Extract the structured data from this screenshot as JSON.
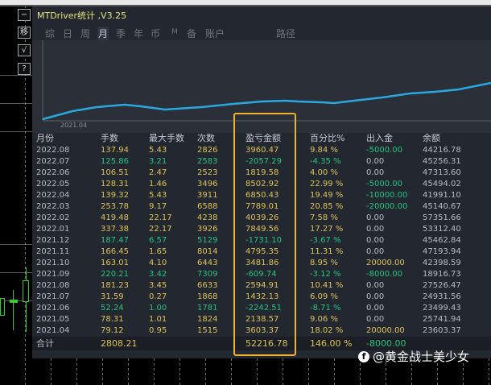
{
  "window": {
    "title": "MTDriver统计 ,V3.25"
  },
  "side_buttons": [
    "−",
    "移",
    "√",
    "?"
  ],
  "tabs": [
    {
      "label": "综",
      "active": false
    },
    {
      "label": "日",
      "active": false
    },
    {
      "label": "周",
      "active": false
    },
    {
      "label": "月",
      "active": true
    },
    {
      "label": "季",
      "active": false
    },
    {
      "label": "年",
      "active": false
    },
    {
      "label": "币",
      "active": false
    },
    {
      "label": "M",
      "active": false
    },
    {
      "label": "备",
      "active": false
    },
    {
      "label": "账户",
      "active": false
    },
    {
      "label": "路径",
      "active": false
    }
  ],
  "chart": {
    "start_label": "2021.04"
  },
  "table": {
    "headers": [
      "月份",
      "手数",
      "最大手数",
      "次数",
      "盈亏金额",
      "百分比%",
      "出入金",
      "余额"
    ],
    "rows": [
      [
        "2022.08",
        "137.94",
        "5.43",
        "2826",
        "3960.47",
        "9.84 %",
        "-5000.00",
        "44216.78"
      ],
      [
        "2022.07",
        "125.86",
        "3.21",
        "2583",
        "-2057.29",
        "-4.35 %",
        "0.00",
        "45256.31"
      ],
      [
        "2022.06",
        "106.51",
        "2.47",
        "2523",
        "1819.58",
        "4.00 %",
        "0.00",
        "47313.60"
      ],
      [
        "2022.05",
        "128.31",
        "1.46",
        "3496",
        "8502.92",
        "22.99 %",
        "-5000.00",
        "45494.02"
      ],
      [
        "2022.04",
        "139.32",
        "5.43",
        "3911",
        "6850.43",
        "19.49 %",
        "-10000.00",
        "41991.10"
      ],
      [
        "2022.03",
        "253.78",
        "9.17",
        "6588",
        "7789.01",
        "20.85 %",
        "-20000.00",
        "45140.67"
      ],
      [
        "2022.02",
        "419.48",
        "22.17",
        "4238",
        "4039.26",
        "7.58 %",
        "0.00",
        "57351.66"
      ],
      [
        "2022.01",
        "337.38",
        "22.17",
        "3926",
        "7849.56",
        "17.27 %",
        "0.00",
        "53312.40"
      ],
      [
        "2021.12",
        "187.47",
        "6.57",
        "5129",
        "-1731.10",
        "-3.67 %",
        "0.00",
        "45462.84"
      ],
      [
        "2021.11",
        "166.45",
        "1.65",
        "8014",
        "4795.35",
        "11.31 %",
        "0.00",
        "47193.94"
      ],
      [
        "2021.10",
        "163.01",
        "4.10",
        "6443",
        "3481.86",
        "8.95 %",
        "20000.00",
        "42398.59"
      ],
      [
        "2021.09",
        "220.21",
        "3.42",
        "7309",
        "-609.74",
        "-3.12 %",
        "-8000.00",
        "18916.73"
      ],
      [
        "2021.08",
        "181.23",
        "3.45",
        "6633",
        "2594.91",
        "10.41 %",
        "0.00",
        "27526.47"
      ],
      [
        "2021.07",
        "31.59",
        "0.27",
        "1868",
        "1432.13",
        "6.09 %",
        "0.00",
        "24931.56"
      ],
      [
        "2021.06",
        "52.24",
        "1.00",
        "1781",
        "-2242.51",
        "-8.71 %",
        "0.00",
        "23499.43"
      ],
      [
        "2021.05",
        "78.31",
        "1.01",
        "1824",
        "2138.57",
        "9.06 %",
        "0.00",
        "25741.94"
      ],
      [
        "2021.04",
        "79.12",
        "0.95",
        "1515",
        "3603.37",
        "18.02 %",
        "20000.00",
        "23603.37"
      ]
    ],
    "total": {
      "label": "合计",
      "lots": "2808.21",
      "profit": "52216.78",
      "percent": "146.00 %",
      "deposit": "-8000.00"
    }
  },
  "watermark": {
    "text": "@黄金战士美少女",
    "icon": "facebook-icon"
  },
  "colors": {
    "positive": "#dcc25a",
    "negative": "#25c283",
    "neutral": "#b7bbc6",
    "highlight": "#f0b22a",
    "line": "#29a8df"
  }
}
